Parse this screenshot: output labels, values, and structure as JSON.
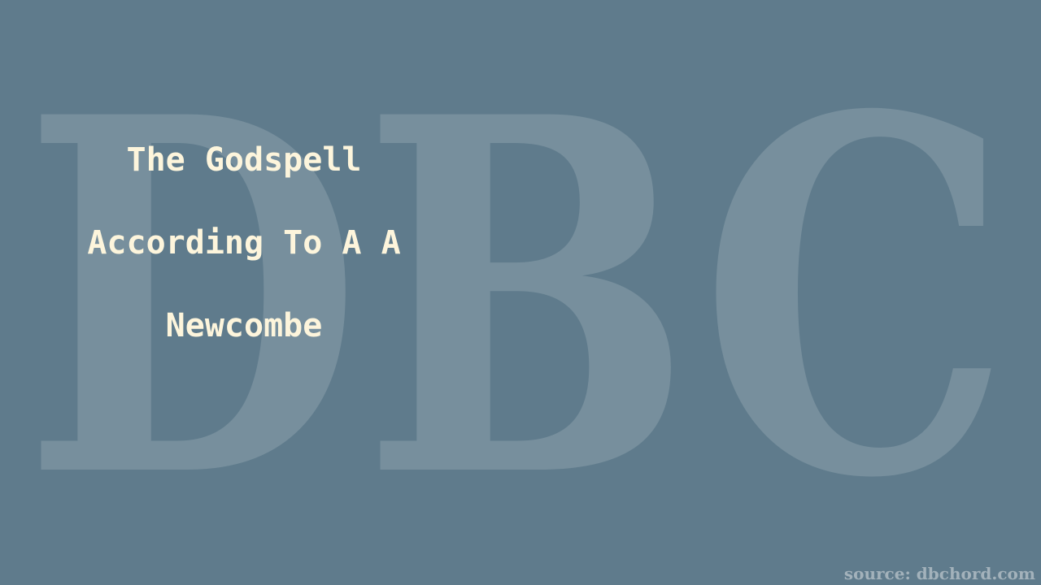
{
  "watermark": {
    "logo_text": "DBC",
    "color": "#7a929f"
  },
  "background_color": "#5f7b8c",
  "title_color": "#fdf5dc",
  "title_lines": [
    "The Godspell",
    "According To A A",
    "Newcombe"
  ],
  "source": "source: dbchord.com"
}
